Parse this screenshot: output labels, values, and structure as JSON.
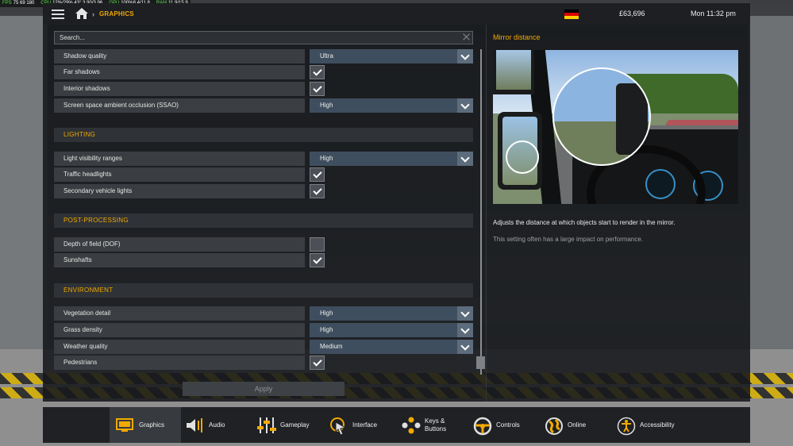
{
  "hud": {
    "fps_label": "FPS",
    "fps": "75",
    "fps_detail": "69 180",
    "cpu_label": "CPU",
    "cpu": "12%/29%",
    "cpu_temp": "43°",
    "cpu_freq": "3.90/3.96",
    "gpu_label": "GPU",
    "gpu": "100%8.4/11.8",
    "ram_label": "RAM",
    "ram": "11.9/15.9"
  },
  "topbar": {
    "breadcrumb": "GRAPHICS",
    "money": "£63,696",
    "clock": "Mon 11:32 pm",
    "flag_colors": [
      "#000000",
      "#dd0000",
      "#ffce00"
    ]
  },
  "search": {
    "placeholder": "Search..."
  },
  "settings": {
    "shadow_quality": {
      "label": "Shadow quality",
      "value": "Ultra"
    },
    "far_shadows": {
      "label": "Far shadows",
      "checked": true
    },
    "interior_shadows": {
      "label": "Interior shadows",
      "checked": true
    },
    "ssao": {
      "label": "Screen space ambient occlusion (SSAO)",
      "value": "High"
    },
    "lighting_header": "LIGHTING",
    "light_visibility": {
      "label": "Light visibility ranges",
      "value": "High"
    },
    "traffic_headlights": {
      "label": "Traffic headlights",
      "checked": true
    },
    "secondary_lights": {
      "label": "Secondary vehicle lights",
      "checked": true
    },
    "post_header": "POST-PROCESSING",
    "dof": {
      "label": "Depth of field (DOF)",
      "checked": false
    },
    "sunshafts": {
      "label": "Sunshafts",
      "checked": true
    },
    "env_header": "ENVIRONMENT",
    "vegetation": {
      "label": "Vegetation detail",
      "value": "High"
    },
    "grass": {
      "label": "Grass density",
      "value": "High"
    },
    "weather": {
      "label": "Weather quality",
      "value": "Medium"
    },
    "pedestrians": {
      "label": "Pedestrians",
      "checked": true
    }
  },
  "apply_label": "Apply",
  "info": {
    "title": "Mirror distance",
    "description": "Adjusts the distance at which objects start to render in the mirror.",
    "note": "This setting often has a large impact on performance."
  },
  "tabs": [
    {
      "label": "Graphics",
      "icon": "monitor-icon"
    },
    {
      "label": "Audio",
      "icon": "speaker-icon"
    },
    {
      "label": "Gameplay",
      "icon": "sliders-icon"
    },
    {
      "label": "Interface",
      "icon": "cursor-icon"
    },
    {
      "label": "Keys & Buttons",
      "icon": "keys-icon"
    },
    {
      "label": "Controls",
      "icon": "steering-wheel-icon"
    },
    {
      "label": "Online",
      "icon": "globe-icon"
    },
    {
      "label": "Accessibility",
      "icon": "accessibility-icon"
    }
  ],
  "accent_color": "#f2a900"
}
